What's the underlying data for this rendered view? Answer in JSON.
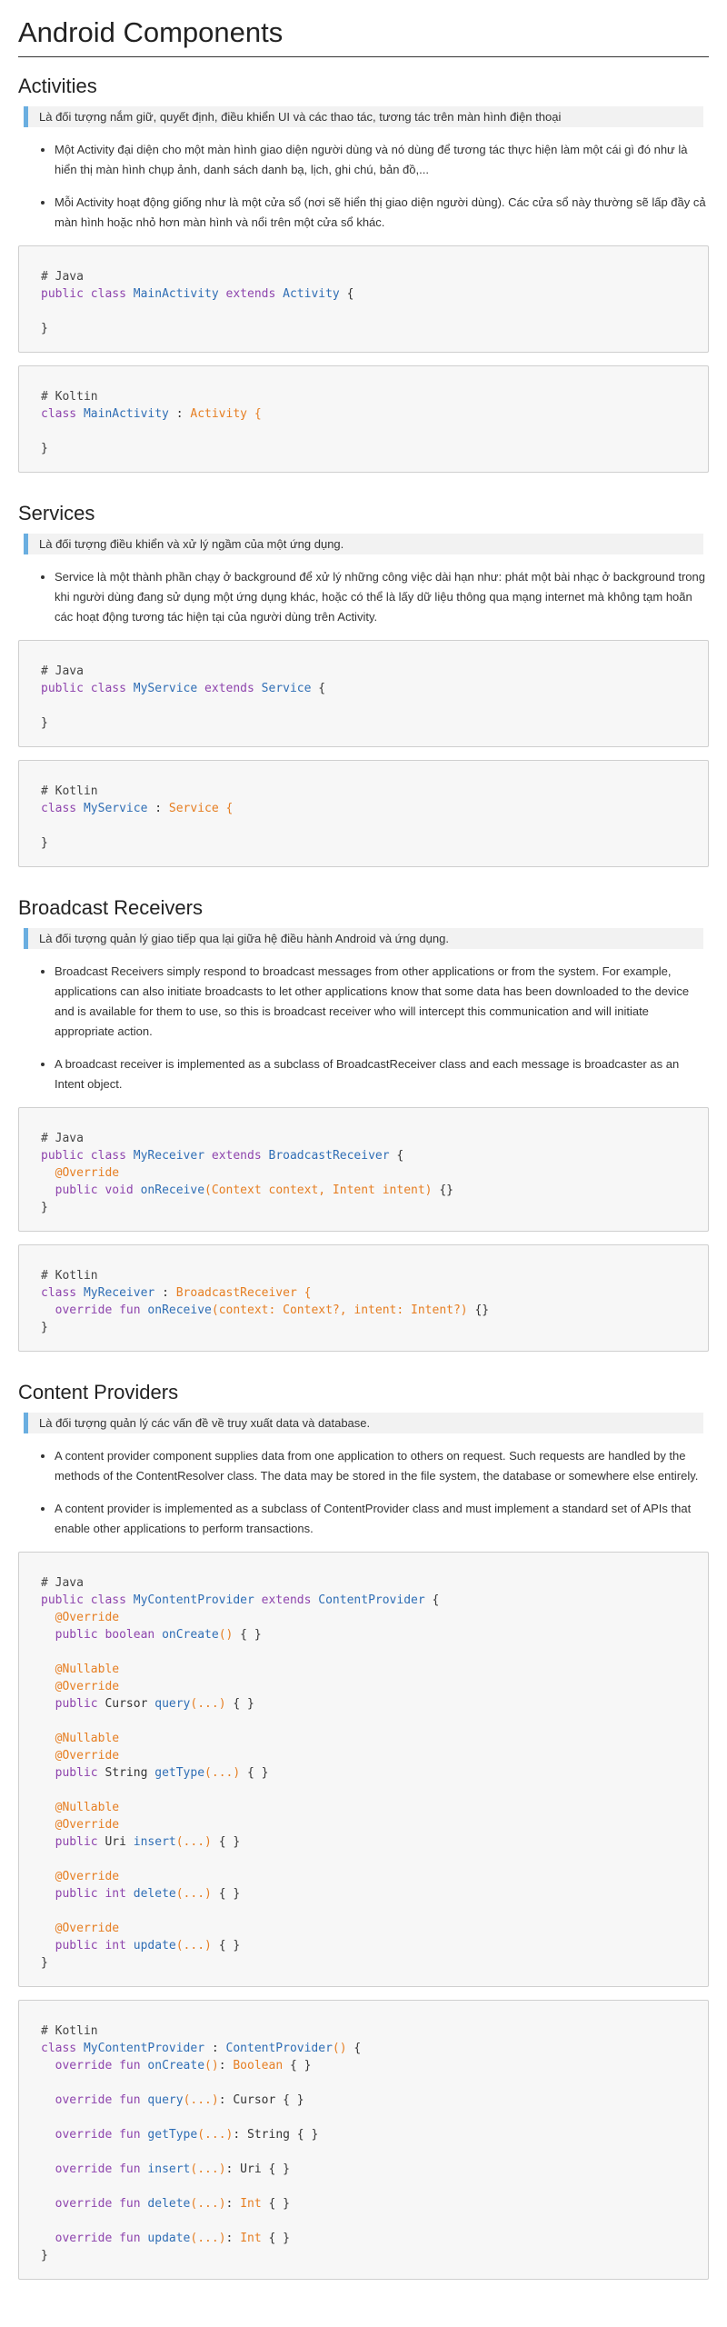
{
  "title": "Android Components",
  "sections": [
    {
      "heading": "Activities",
      "quote": "Là đối tượng nắm giữ, quyết định, điều khiển UI và các thao tác, tương tác trên màn hình điện thoại",
      "bullets": [
        "Một Activity đại diện cho một màn hình giao diện người dùng và nó dùng để tương tác thực hiện làm một cái gì đó như là hiển thị màn hình chụp ảnh, danh sách danh bạ, lịch, ghi chú, bản đồ,...",
        "Mỗi Activity hoạt động giống như là một cửa sổ (nơi sẽ hiển thị giao diện người dùng). Các cửa sổ này thường sẽ lấp đầy cả màn hình hoặc nhỏ hơn màn hình và nổi trên một cửa sổ khác."
      ],
      "code": [
        [
          "# Java",
          "public class MainActivity extends Activity {",
          "",
          "}"
        ],
        [
          "# Koltin",
          "class MainActivity : Activity {",
          "",
          "}"
        ]
      ]
    },
    {
      "heading": "Services",
      "quote": "Là đối tượng điều khiển và xử lý ngầm của một ứng dụng.",
      "bullets": [
        "Service là một thành phần chạy ở background để xử lý những công việc dài hạn như: phát một bài nhạc ở background trong khi người dùng đang sử dụng một ứng dụng khác, hoặc có thể là lấy dữ liệu thông qua mạng internet mà không tạm hoãn các hoạt động tương tác hiện tại của người dùng trên Activity."
      ],
      "code": [
        [
          "# Java",
          "public class MyService extends Service {",
          "",
          "}"
        ],
        [
          "# Kotlin",
          "class MyService : Service {",
          "",
          "}"
        ]
      ]
    },
    {
      "heading": "Broadcast Receivers",
      "quote": "Là đối tượng quản lý giao tiếp qua lại giữa hệ điều hành Android và ứng dụng.",
      "bullets": [
        "Broadcast Receivers simply respond to broadcast messages from other applications or from the system. For example, applications can also initiate broadcasts to let other applications know that some data has been downloaded to the device and is available for them to use, so this is broadcast receiver who will intercept this communication and will initiate appropriate action.",
        "A broadcast receiver is implemented as a subclass of BroadcastReceiver class and each message is broadcaster as an Intent object."
      ],
      "code": [
        [
          "# Java",
          "public class MyReceiver extends BroadcastReceiver {",
          "  @Override",
          "  public void onReceive(Context context, Intent intent) {}",
          "}"
        ],
        [
          "# Kotlin",
          "class MyReceiver : BroadcastReceiver {",
          "  override fun onReceive(context: Context?, intent: Intent?) {}",
          "}"
        ]
      ]
    },
    {
      "heading": "Content Providers",
      "quote": "Là đối tượng quản lý các vấn đề về truy xuất data và database.",
      "bullets": [
        "A content provider component supplies data from one application to others on request. Such requests are handled by the methods of the ContentResolver class. The data may be stored in the file system, the database or somewhere else entirely.",
        "A content provider is implemented as a subclass of ContentProvider class and must implement a standard set of APIs that enable other applications to perform transactions."
      ],
      "code": [
        [
          "# Java",
          "public class MyContentProvider extends ContentProvider {",
          "  @Override",
          "  public boolean onCreate() { }",
          "",
          "  @Nullable",
          "  @Override",
          "  public Cursor query(...) { }",
          "",
          "  @Nullable",
          "  @Override",
          "  public String getType(...) { }",
          "",
          "  @Nullable",
          "  @Override",
          "  public Uri insert(...) { }",
          "",
          "  @Override",
          "  public int delete(...) { }",
          "",
          "  @Override",
          "  public int update(...) { }",
          "}"
        ],
        [
          "# Kotlin",
          "class MyContentProvider : ContentProvider() {",
          "  override fun onCreate(): Boolean { }",
          "",
          "  override fun query(...): Cursor { }",
          "",
          "  override fun getType(...): String { }",
          "",
          "  override fun insert(...): Uri { }",
          "",
          "  override fun delete(...): Int { }",
          "",
          "  override fun update(...): Int { }",
          "}"
        ]
      ]
    }
  ]
}
